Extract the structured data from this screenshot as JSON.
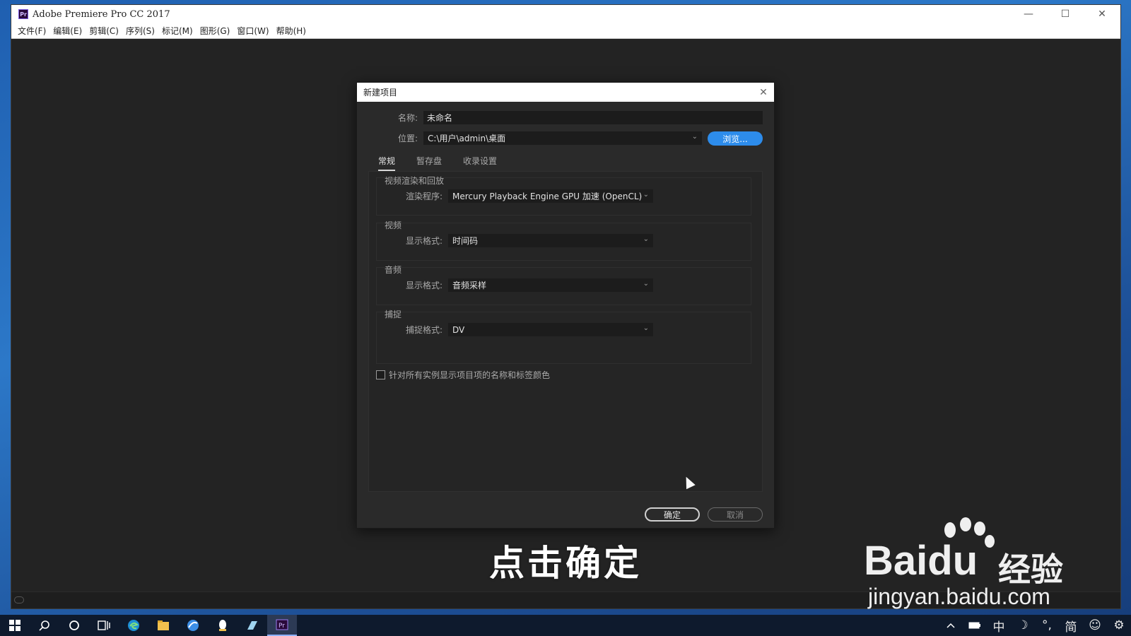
{
  "window": {
    "app_badge": "Pr",
    "title": "Adobe Premiere Pro CC 2017",
    "minimize": "—",
    "maximize": "☐",
    "close": "✕"
  },
  "menu": [
    {
      "label": "文件(F)"
    },
    {
      "label": "编辑(E)"
    },
    {
      "label": "剪辑(C)"
    },
    {
      "label": "序列(S)"
    },
    {
      "label": "标记(M)"
    },
    {
      "label": "图形(G)"
    },
    {
      "label": "窗口(W)"
    },
    {
      "label": "帮助(H)"
    }
  ],
  "dialog": {
    "title": "新建项目",
    "close": "✕",
    "name_label": "名称:",
    "name_value": "未命名",
    "location_label": "位置:",
    "location_value": "C:\\用户\\admin\\桌面",
    "browse_button": "浏览...",
    "tabs": [
      {
        "label": "常规",
        "active": true
      },
      {
        "label": "暂存盘",
        "active": false
      },
      {
        "label": "收录设置",
        "active": false
      }
    ],
    "groups": {
      "render": {
        "title": "视频渲染和回放",
        "label": "渲染程序:",
        "value": "Mercury Playback Engine GPU 加速 (OpenCL)"
      },
      "video": {
        "title": "视频",
        "label": "显示格式:",
        "value": "时间码"
      },
      "audio": {
        "title": "音频",
        "label": "显示格式:",
        "value": "音频采样"
      },
      "capture": {
        "title": "捕捉",
        "label": "捕捉格式:",
        "value": "DV"
      }
    },
    "checkbox_label": "针对所有实例显示项目项的名称和标签颜色",
    "checkbox_checked": false,
    "ok_button": "确定",
    "cancel_button": "取消"
  },
  "subtitle": "点击确定",
  "watermark": {
    "brand": "Bai",
    "brand_du": "du",
    "cn": "经验",
    "url": "jingyan.baidu.com"
  },
  "taskbar": {
    "icons": [
      "windows-start",
      "search",
      "cortana",
      "task-view",
      "edge",
      "file-explorer",
      "browser",
      "qq",
      "notepad",
      "premiere-pro"
    ],
    "tray_ime": "中",
    "tray_moon": "☽",
    "tray_punct": "°,",
    "tray_simplified": "简",
    "tray_emoji": "☺",
    "tray_settings": "⚙"
  },
  "colors": {
    "accent_blue": "#2d8ceb",
    "panel_bg": "#2a2a2a",
    "workspace_bg": "#232323",
    "premiere_purple": "#7a5ae0"
  }
}
